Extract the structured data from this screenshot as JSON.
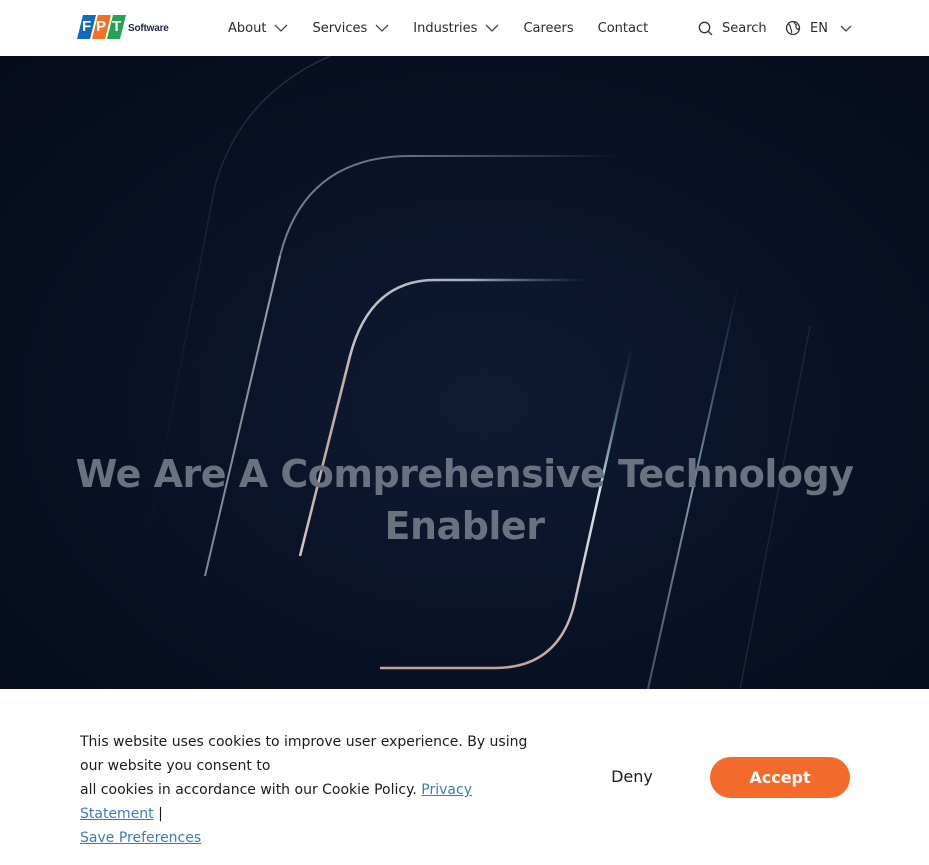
{
  "brand": {
    "logo_letters": [
      "F",
      "P",
      "T"
    ],
    "logo_text": "Software",
    "colors": {
      "blue": "#0f6cbd",
      "orange": "#f37021",
      "green": "#23a455"
    }
  },
  "nav": {
    "items": [
      {
        "label": "About",
        "has_dropdown": true
      },
      {
        "label": "Services",
        "has_dropdown": true
      },
      {
        "label": "Industries",
        "has_dropdown": true
      },
      {
        "label": "Careers",
        "has_dropdown": false
      },
      {
        "label": "Contact",
        "has_dropdown": false
      }
    ],
    "search_label": "Search",
    "search_icon": "search-icon",
    "language": "EN",
    "language_icon": "globe-icon"
  },
  "hero": {
    "title_line1": "We Are A Comprehensive Technology",
    "title_line2": "Enabler",
    "background": "#07101f"
  },
  "cookie_banner": {
    "text_part1": "This website uses cookies to improve user experience. By using our website you consent to",
    "text_part2": "all cookies in accordance with our Cookie Policy.",
    "privacy_link": "Privacy Statement",
    "separator": "|",
    "preferences_link": "Save Preferences",
    "deny_label": "Deny",
    "accept_label": "Accept",
    "accent_color": "#f26b2b"
  }
}
